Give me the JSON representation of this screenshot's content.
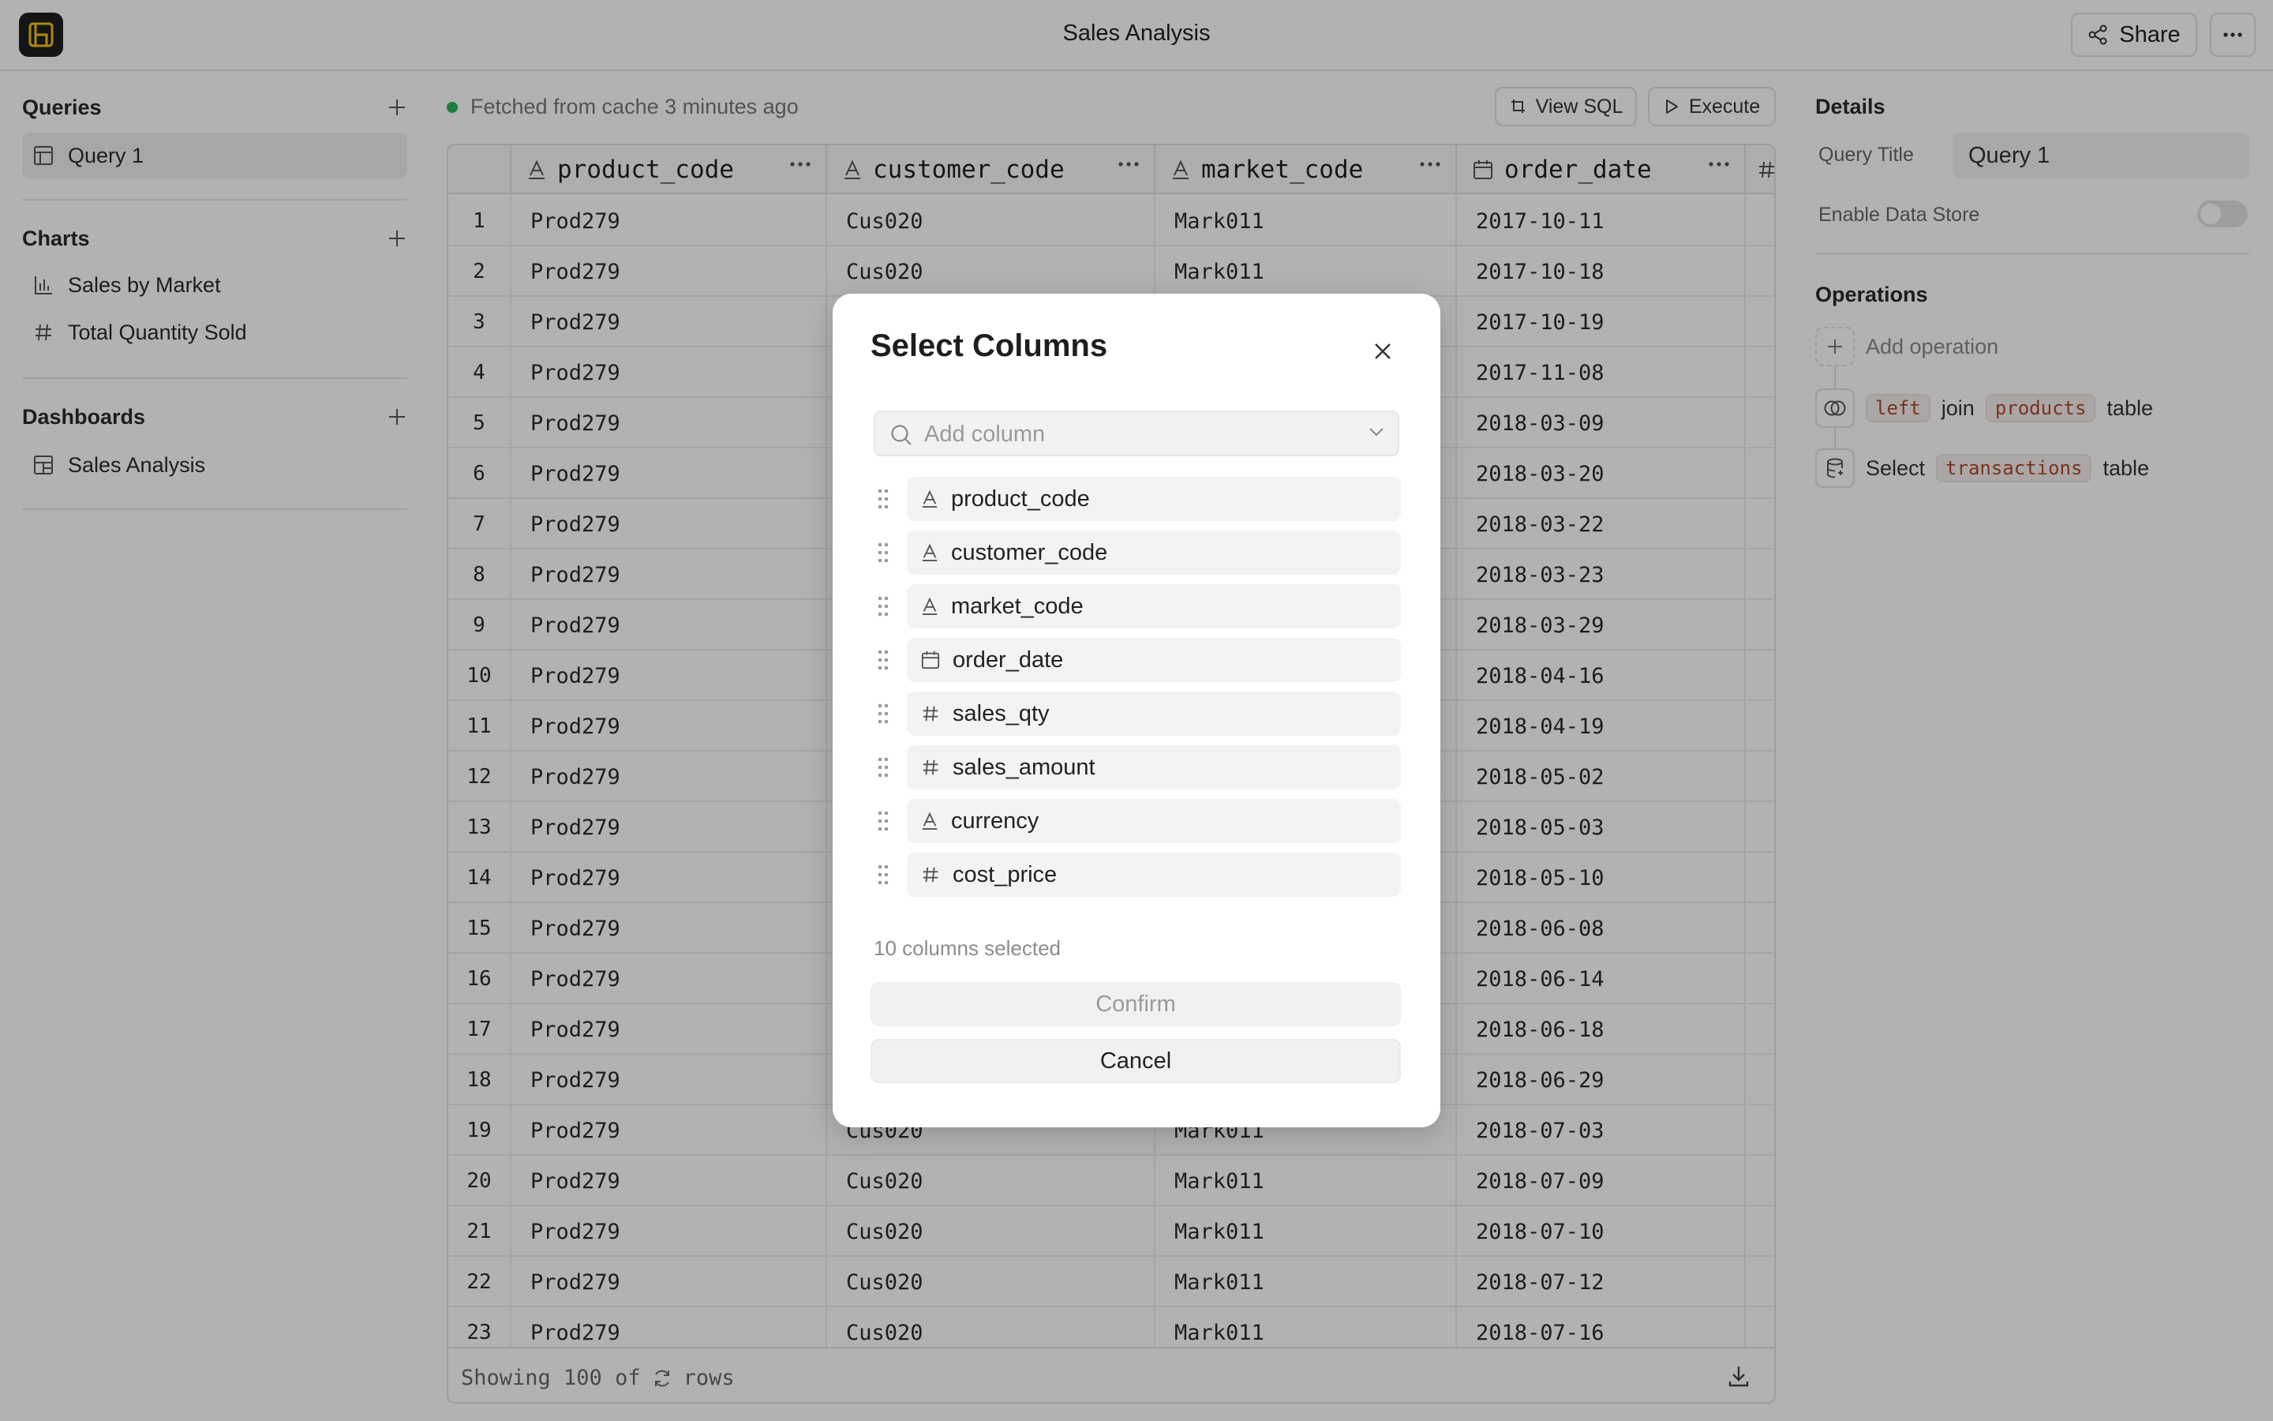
{
  "app": {
    "title": "Sales Analysis",
    "share_label": "Share"
  },
  "sidebar": {
    "queries": {
      "title": "Queries",
      "items": [
        {
          "label": "Query 1",
          "icon": "table-icon"
        }
      ]
    },
    "charts": {
      "title": "Charts",
      "items": [
        {
          "label": "Sales by Market",
          "icon": "bar-chart-icon"
        },
        {
          "label": "Total Quantity Sold",
          "icon": "hash-icon"
        }
      ]
    },
    "dashboards": {
      "title": "Dashboards",
      "items": [
        {
          "label": "Sales Analysis",
          "icon": "dashboard-icon"
        }
      ]
    }
  },
  "main": {
    "status_text": "Fetched from cache 3 minutes ago",
    "view_sql_label": "View SQL",
    "execute_label": "Execute",
    "columns": [
      {
        "name": "product_code",
        "type": "text"
      },
      {
        "name": "customer_code",
        "type": "text"
      },
      {
        "name": "market_code",
        "type": "text"
      },
      {
        "name": "order_date",
        "type": "date"
      }
    ],
    "rows": [
      {
        "n": "1",
        "product_code": "Prod279",
        "customer_code": "Cus020",
        "market_code": "Mark011",
        "order_date": "2017-10-11"
      },
      {
        "n": "2",
        "product_code": "Prod279",
        "customer_code": "Cus020",
        "market_code": "Mark011",
        "order_date": "2017-10-18"
      },
      {
        "n": "3",
        "product_code": "Prod279",
        "customer_code": "",
        "market_code": "",
        "order_date": "2017-10-19"
      },
      {
        "n": "4",
        "product_code": "Prod279",
        "customer_code": "",
        "market_code": "",
        "order_date": "2017-11-08"
      },
      {
        "n": "5",
        "product_code": "Prod279",
        "customer_code": "",
        "market_code": "",
        "order_date": "2018-03-09"
      },
      {
        "n": "6",
        "product_code": "Prod279",
        "customer_code": "",
        "market_code": "",
        "order_date": "2018-03-20"
      },
      {
        "n": "7",
        "product_code": "Prod279",
        "customer_code": "",
        "market_code": "",
        "order_date": "2018-03-22"
      },
      {
        "n": "8",
        "product_code": "Prod279",
        "customer_code": "",
        "market_code": "",
        "order_date": "2018-03-23"
      },
      {
        "n": "9",
        "product_code": "Prod279",
        "customer_code": "",
        "market_code": "",
        "order_date": "2018-03-29"
      },
      {
        "n": "10",
        "product_code": "Prod279",
        "customer_code": "",
        "market_code": "",
        "order_date": "2018-04-16"
      },
      {
        "n": "11",
        "product_code": "Prod279",
        "customer_code": "",
        "market_code": "",
        "order_date": "2018-04-19"
      },
      {
        "n": "12",
        "product_code": "Prod279",
        "customer_code": "",
        "market_code": "",
        "order_date": "2018-05-02"
      },
      {
        "n": "13",
        "product_code": "Prod279",
        "customer_code": "",
        "market_code": "",
        "order_date": "2018-05-03"
      },
      {
        "n": "14",
        "product_code": "Prod279",
        "customer_code": "",
        "market_code": "",
        "order_date": "2018-05-10"
      },
      {
        "n": "15",
        "product_code": "Prod279",
        "customer_code": "",
        "market_code": "",
        "order_date": "2018-06-08"
      },
      {
        "n": "16",
        "product_code": "Prod279",
        "customer_code": "",
        "market_code": "",
        "order_date": "2018-06-14"
      },
      {
        "n": "17",
        "product_code": "Prod279",
        "customer_code": "",
        "market_code": "",
        "order_date": "2018-06-18"
      },
      {
        "n": "18",
        "product_code": "Prod279",
        "customer_code": "",
        "market_code": "",
        "order_date": "2018-06-29"
      },
      {
        "n": "19",
        "product_code": "Prod279",
        "customer_code": "Cus020",
        "market_code": "Mark011",
        "order_date": "2018-07-03"
      },
      {
        "n": "20",
        "product_code": "Prod279",
        "customer_code": "Cus020",
        "market_code": "Mark011",
        "order_date": "2018-07-09"
      },
      {
        "n": "21",
        "product_code": "Prod279",
        "customer_code": "Cus020",
        "market_code": "Mark011",
        "order_date": "2018-07-10"
      },
      {
        "n": "22",
        "product_code": "Prod279",
        "customer_code": "Cus020",
        "market_code": "Mark011",
        "order_date": "2018-07-12"
      },
      {
        "n": "23",
        "product_code": "Prod279",
        "customer_code": "Cus020",
        "market_code": "Mark011",
        "order_date": "2018-07-16"
      }
    ],
    "footer": {
      "showing": "Showing 100 of",
      "rows_word": "rows"
    }
  },
  "details": {
    "title": "Details",
    "query_title_label": "Query Title",
    "query_title_value": "Query 1",
    "enable_store_label": "Enable Data Store",
    "enable_store_on": false,
    "operations_title": "Operations",
    "add_operation_label": "Add operation",
    "op_join": {
      "type": "left",
      "word_join": "join",
      "table": "products",
      "word_table": "table"
    },
    "op_select": {
      "word_select": "Select",
      "table": "transactions",
      "word_table": "table"
    }
  },
  "modal": {
    "title": "Select Columns",
    "search_placeholder": "Add column",
    "columns": [
      {
        "name": "product_code",
        "type": "text"
      },
      {
        "name": "customer_code",
        "type": "text"
      },
      {
        "name": "market_code",
        "type": "text"
      },
      {
        "name": "order_date",
        "type": "date"
      },
      {
        "name": "sales_qty",
        "type": "number"
      },
      {
        "name": "sales_amount",
        "type": "number"
      },
      {
        "name": "currency",
        "type": "text"
      },
      {
        "name": "cost_price",
        "type": "number"
      }
    ],
    "selected_count_text": "10 columns selected",
    "confirm_label": "Confirm",
    "cancel_label": "Cancel"
  }
}
